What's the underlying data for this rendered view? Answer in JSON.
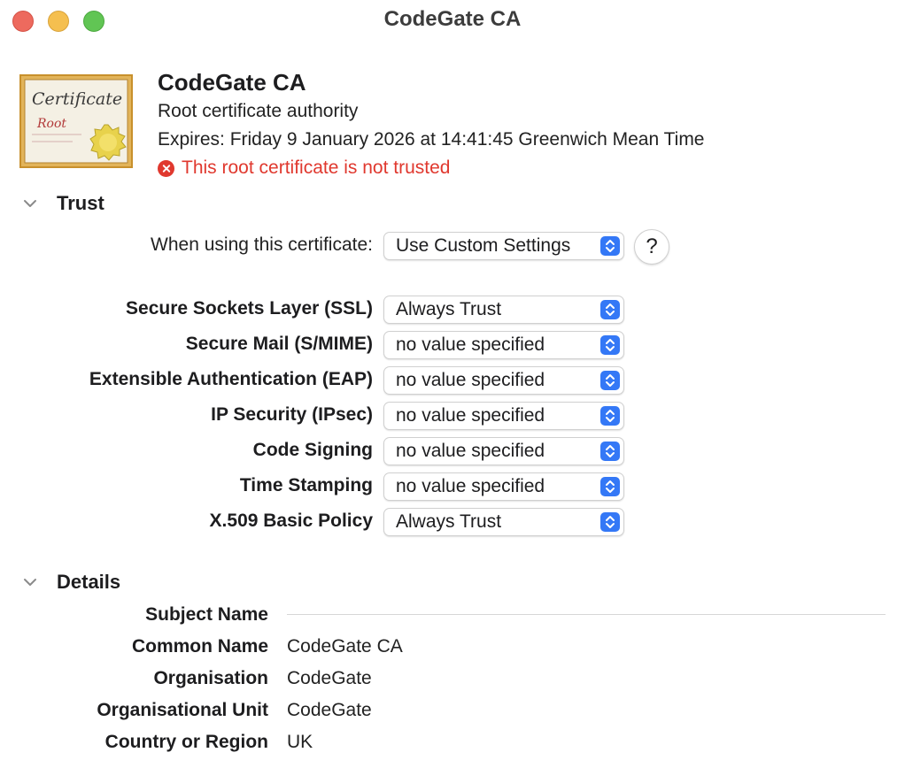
{
  "window": {
    "title": "CodeGate CA"
  },
  "header": {
    "icon_text_line1": "Certificate",
    "icon_text_line2": "Root",
    "name": "CodeGate CA",
    "kind": "Root certificate authority",
    "expiry": "Expires: Friday 9 January 2026 at 14:41:45 Greenwich Mean Time",
    "status": "This root certificate is not trusted"
  },
  "trust": {
    "section_title": "Trust",
    "when_using_label": "When using this certificate:",
    "when_using_value": "Use Custom Settings",
    "help_label": "?",
    "policies": [
      {
        "label": "Secure Sockets Layer (SSL)",
        "value": "Always Trust"
      },
      {
        "label": "Secure Mail (S/MIME)",
        "value": "no value specified"
      },
      {
        "label": "Extensible Authentication (EAP)",
        "value": "no value specified"
      },
      {
        "label": "IP Security (IPsec)",
        "value": "no value specified"
      },
      {
        "label": "Code Signing",
        "value": "no value specified"
      },
      {
        "label": "Time Stamping",
        "value": "no value specified"
      },
      {
        "label": "X.509 Basic Policy",
        "value": "Always Trust"
      }
    ]
  },
  "details": {
    "section_title": "Details",
    "subject_name_label": "Subject Name",
    "fields": [
      {
        "label": "Common Name",
        "value": "CodeGate CA"
      },
      {
        "label": "Organisation",
        "value": "CodeGate"
      },
      {
        "label": "Organisational Unit",
        "value": "CodeGate"
      },
      {
        "label": "Country or Region",
        "value": "UK"
      }
    ]
  },
  "colors": {
    "accent": "#3478f6",
    "error": "#e0382e",
    "close": "#ed6a5e",
    "minimize": "#f5bf4f",
    "zoom": "#61c554"
  }
}
